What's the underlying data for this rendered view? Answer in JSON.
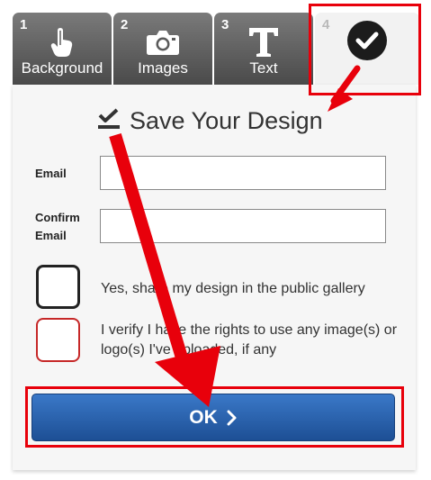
{
  "tabs": [
    {
      "number": "1",
      "label": "Background",
      "icon": "hand-pointer-icon"
    },
    {
      "number": "2",
      "label": "Images",
      "icon": "camera-icon"
    },
    {
      "number": "3",
      "label": "Text",
      "icon": "text-t-icon"
    },
    {
      "number": "4",
      "label": "",
      "icon": "checkmark-circle-icon"
    }
  ],
  "form": {
    "title": "Save Your Design",
    "title_icon": "checkmark-underline-icon",
    "email_label": "Email",
    "email_value": "",
    "confirm_label_line1": "Confirm",
    "confirm_label_line2": "Email",
    "confirm_value": "",
    "share_label": "Yes, share my design in the public gallery",
    "verify_label_line1": "I verify I have the rights to use any image(s) or",
    "verify_label_line2": "logo(s) I've uploaded, if any",
    "ok_label": "OK"
  },
  "annotations": {
    "highlight_color": "#e8000b",
    "arrow_color": "#e8000b"
  }
}
